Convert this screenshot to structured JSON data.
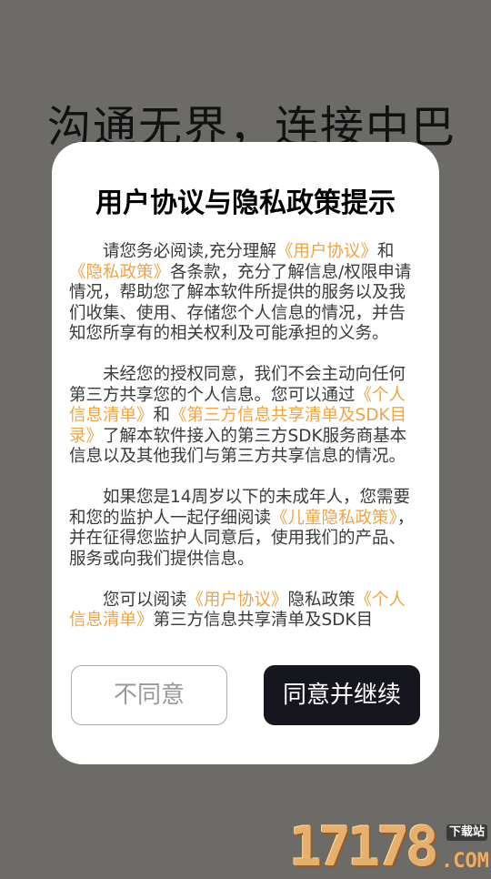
{
  "background": {
    "slogan": "沟通无界，连接中巴"
  },
  "dialog": {
    "title": "用户协议与隐私政策提示",
    "paragraphs": [
      [
        {
          "text": "请您务必阅读,充分理解"
        },
        {
          "text": "《用户协议》",
          "link": true
        },
        {
          "text": "和"
        },
        {
          "text": "《隐私政策》",
          "link": true
        },
        {
          "text": "各条款，充分了解信息/权限申请情况，帮助您了解本软件所提供的服务以及我们收集、使用、存储您个人信息的情况，并告知您所享有的相关权利及可能承担的义务。"
        }
      ],
      [
        {
          "text": "未经您的授权同意，我们不会主动向任何第三方共享您的个人信息。您可以通过"
        },
        {
          "text": "《个人信息清单》",
          "link": true
        },
        {
          "text": "和"
        },
        {
          "text": "《第三方信息共享清单及SDK目录》",
          "link": true
        },
        {
          "text": "了解本软件接入的第三方SDK服务商基本信息以及其他我们与第三方共享信息的情况。"
        }
      ],
      [
        {
          "text": "如果您是14周岁以下的未成年人，您需要和您的监护人一起仔细阅读"
        },
        {
          "text": "《儿童隐私政策》",
          "link": true
        },
        {
          "text": "，并在征得您监护人同意后，使用我们的产品、服务或向我们提供信息。"
        }
      ],
      [
        {
          "text": "您可以阅读"
        },
        {
          "text": "《用户协议》",
          "link": true
        },
        {
          "text": "隐私政策"
        },
        {
          "text": "《个人信息清单》",
          "link": true
        },
        {
          "text": "第三方信息共享清单及SDK目"
        }
      ]
    ],
    "disagree_label": "不同意",
    "agree_label": "同意并继续"
  },
  "watermark": {
    "number": "17178",
    "tag": "下载站",
    "suffix": ".COM"
  },
  "colors": {
    "backdrop": "#6c6b68",
    "dialog_bg": "#ffffff",
    "link": "#f0a347",
    "agree_button_bg": "#16161e",
    "disagree_border": "#aaaaaa"
  }
}
